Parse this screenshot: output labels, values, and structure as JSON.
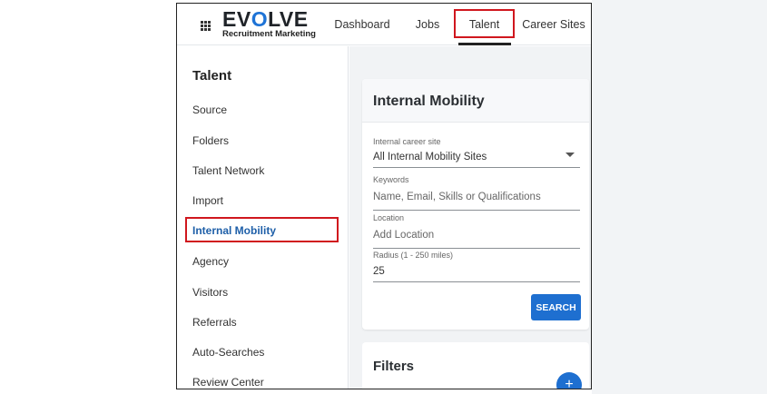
{
  "header": {
    "logo_main_prefix": "EV",
    "logo_main_o": "O",
    "logo_main_suffix": "LVE",
    "logo_sub": "Recruitment Marketing",
    "apps_icon": "grid-icon",
    "nav": [
      {
        "label": "Dashboard"
      },
      {
        "label": "Jobs"
      },
      {
        "label": "Talent"
      },
      {
        "label": "Career Sites"
      }
    ]
  },
  "sidebar": {
    "title": "Talent",
    "items": [
      {
        "label": "Source"
      },
      {
        "label": "Folders"
      },
      {
        "label": "Talent Network"
      },
      {
        "label": "Import"
      },
      {
        "label": "Internal Mobility"
      },
      {
        "label": "Agency"
      },
      {
        "label": "Visitors"
      },
      {
        "label": "Referrals"
      },
      {
        "label": "Auto-Searches"
      },
      {
        "label": "Review Center"
      }
    ]
  },
  "main": {
    "card_title": "Internal Mobility",
    "career_site": {
      "label": "Internal career site",
      "value": "All Internal Mobility Sites"
    },
    "keywords": {
      "label": "Keywords",
      "placeholder": "Name, Email, Skills or Qualifications"
    },
    "location": {
      "label": "Location",
      "placeholder": "Add Location"
    },
    "radius": {
      "label": "Radius (1 - 250 miles)",
      "value": "25"
    },
    "search_label": "SEARCH",
    "filters_title": "Filters",
    "fab_label": "+"
  },
  "colors": {
    "accent": "#1e6fd0",
    "highlight": "#d0171e",
    "active_text": "#1e5fa8"
  }
}
